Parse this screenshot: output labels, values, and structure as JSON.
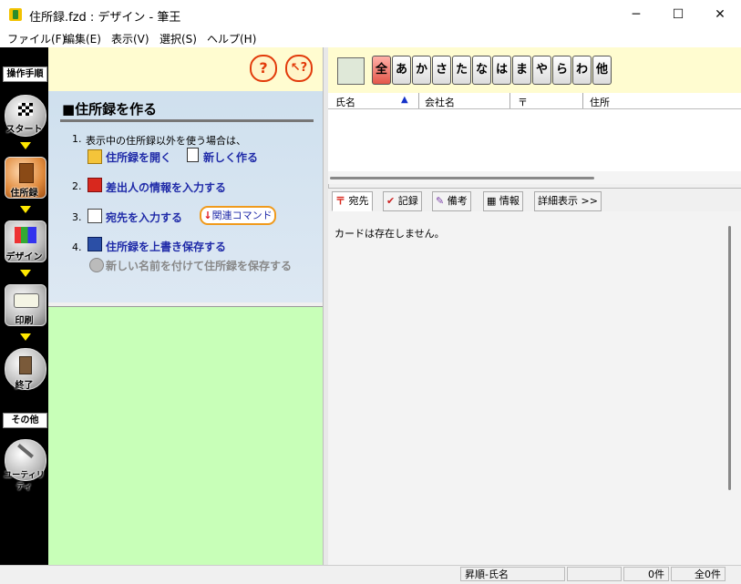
{
  "window": {
    "title": "住所録.fzd : デザイン - 筆王",
    "minimize_label": "─",
    "maximize_label": "☐",
    "close_label": "✕"
  },
  "menu": [
    "ファイル(F)",
    "編集(E)",
    "表示(V)",
    "選択(S)",
    "ヘルプ(H)"
  ],
  "sidebar": {
    "header_procedure": "操作手順",
    "header_other": "その他",
    "items": [
      {
        "label": "スタート",
        "icon": "checkered-flag-icon"
      },
      {
        "label": "住所録",
        "icon": "address-book-icon"
      },
      {
        "label": "デザイン",
        "icon": "design-palette-icon"
      },
      {
        "label": "印刷",
        "icon": "printer-icon"
      },
      {
        "label": "終了",
        "icon": "exit-door-icon"
      },
      {
        "label": "ユーティリティ",
        "icon": "tools-icon"
      }
    ]
  },
  "help": {
    "help_label": "?",
    "pointer_help_label": "↖?"
  },
  "guide": {
    "title": "■住所録を作る",
    "step1_num": "1.",
    "step1_text": "表示中の住所録以外を使う場合は、",
    "open_label": "住所録を開く",
    "new_label": "新しく作る",
    "step2_num": "2.",
    "step2_link": "差出人の情報を入力する",
    "step3_num": "3.",
    "step3_link": "宛先を入力する",
    "related_label": "関連コマンド",
    "step4_num": "4.",
    "step4_link": "住所録を上書き保存する",
    "save_as_link": "新しい名前を付けて住所録を保存する"
  },
  "kana": [
    "全",
    "あ",
    "か",
    "さ",
    "た",
    "な",
    "は",
    "ま",
    "や",
    "ら",
    "わ",
    "他"
  ],
  "list": {
    "columns": [
      "氏名",
      "会社名",
      "〒",
      "住所"
    ],
    "sort_marker": "▲"
  },
  "tabs": [
    "宛先",
    "記録",
    "備考",
    "情報",
    "詳細表示 >>"
  ],
  "card": {
    "message": "カードは存在しません。"
  },
  "status": {
    "sort": "昇順-氏名",
    "count": "0件",
    "total": "全0件"
  },
  "colors": {
    "accent_help": "#e23b0b",
    "left_bottom_bg": "#c8ffb8",
    "kana_bg": "#fffcd0"
  }
}
